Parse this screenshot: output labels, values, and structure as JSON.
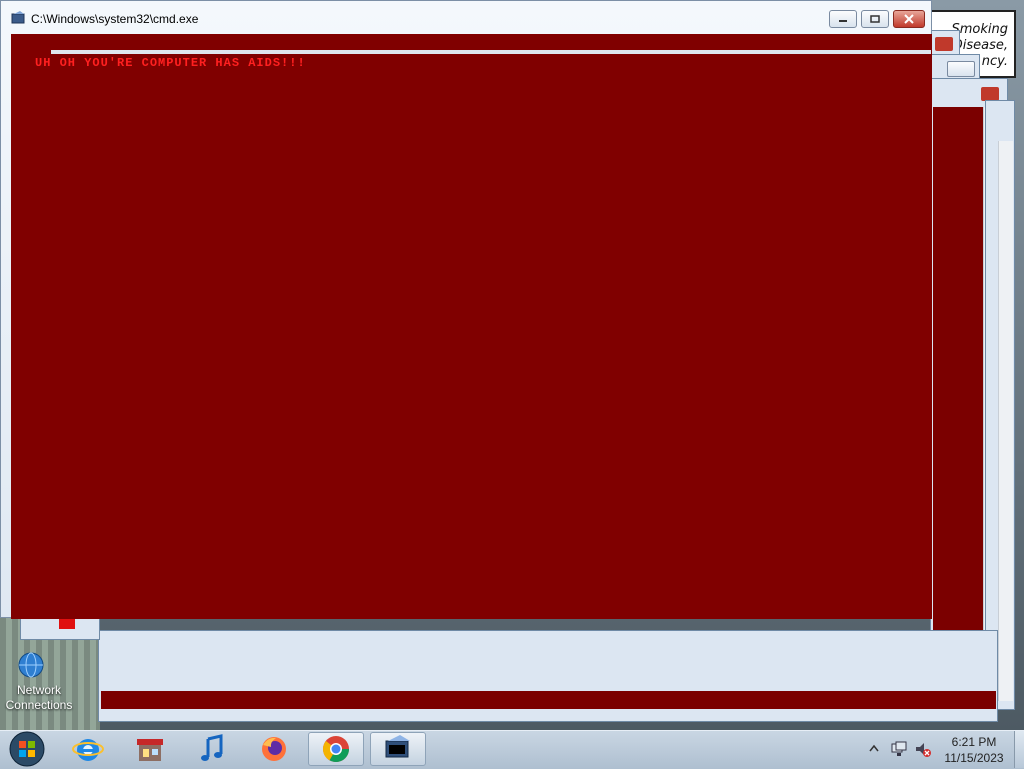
{
  "desktop": {
    "billboard_lines": [
      "Smoking",
      "Disease,",
      "ncy."
    ],
    "icons": [
      {
        "label_line1": "Network",
        "label_line2": "Connections"
      }
    ]
  },
  "window": {
    "title": "C:\\Windows\\system32\\cmd.exe",
    "console_text": "UH OH YOU'RE COMPUTER HAS AIDS!!!",
    "console_bg": "#800000",
    "console_fg": "#ff2020"
  },
  "taskbar": {
    "buttons": [
      {
        "name": "start",
        "icon": "windows-orb-icon"
      },
      {
        "name": "internet-explorer",
        "icon": "internet-explorer-icon"
      },
      {
        "name": "store",
        "icon": "store-icon"
      },
      {
        "name": "itunes",
        "icon": "music-note-icon"
      },
      {
        "name": "firefox",
        "icon": "firefox-icon"
      },
      {
        "name": "chrome",
        "icon": "chrome-icon"
      },
      {
        "name": "cmd",
        "icon": "cmd-window-icon"
      }
    ],
    "time": "6:21 PM",
    "date": "11/15/2023"
  }
}
